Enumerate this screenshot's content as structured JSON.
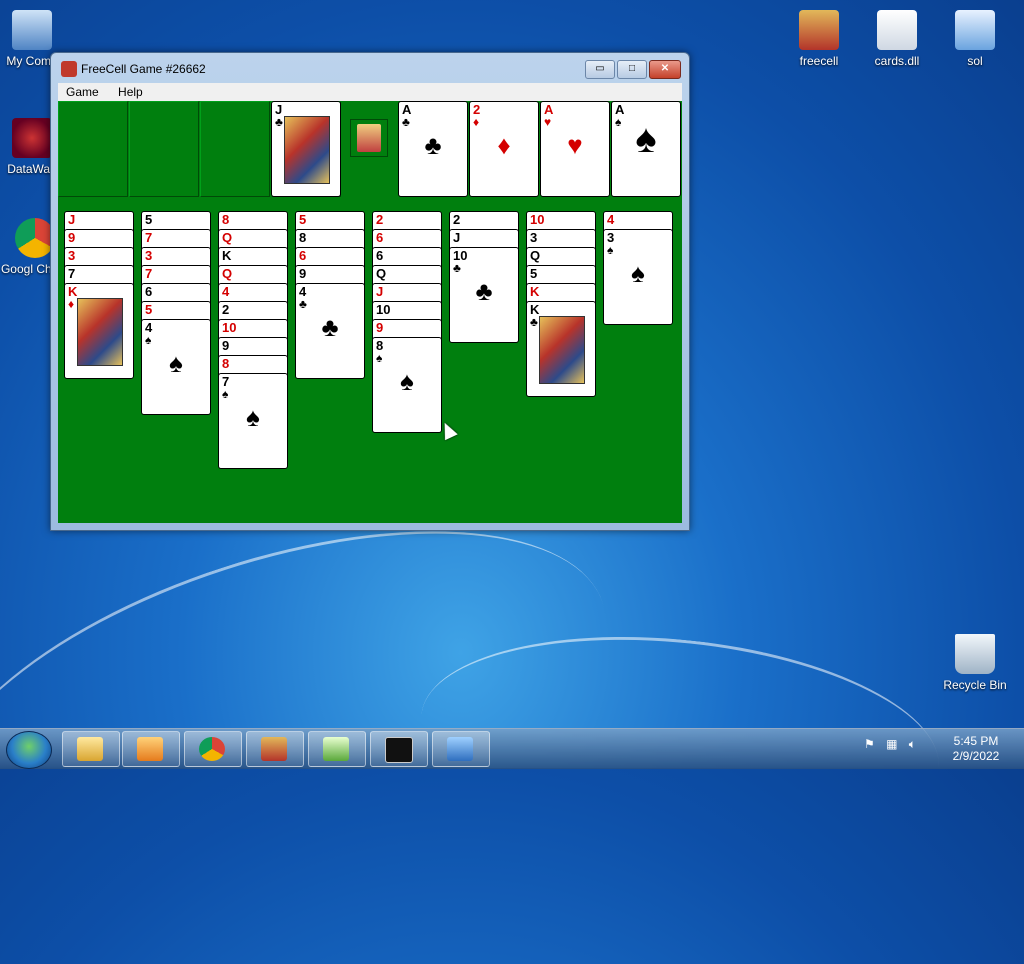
{
  "desktop": {
    "icons": [
      {
        "label": "My Comp"
      },
      {
        "label": "DataWag"
      },
      {
        "label": "Googl Chron"
      },
      {
        "label": "freecell"
      },
      {
        "label": "cards.dll"
      },
      {
        "label": "sol"
      },
      {
        "label": "Recycle Bin"
      }
    ]
  },
  "window": {
    "title": "FreeCell Game #26662",
    "buttons": {
      "minimize": "▭",
      "maximize": "□",
      "close": "✕"
    },
    "menu": [
      "Game",
      "Help"
    ]
  },
  "game": {
    "freecell_card": {
      "rank": "J",
      "suit": "♣",
      "color": "black"
    },
    "foundations": [
      {
        "rank": "A",
        "suit": "♣",
        "color": "black"
      },
      {
        "rank": "2",
        "suit": "♦",
        "color": "red"
      },
      {
        "rank": "A",
        "suit": "♥",
        "color": "red"
      },
      {
        "rank": "A",
        "suit": "♠",
        "color": "black"
      }
    ],
    "columns": [
      [
        {
          "r": "J",
          "s": "♥"
        },
        {
          "r": "9",
          "s": "♥"
        },
        {
          "r": "3",
          "s": "♥"
        },
        {
          "r": "7",
          "s": "♠"
        },
        {
          "r": "K",
          "s": "♦"
        }
      ],
      [
        {
          "r": "5",
          "s": "♠"
        },
        {
          "r": "7",
          "s": "♥"
        },
        {
          "r": "3",
          "s": "♥"
        },
        {
          "r": "7",
          "s": "♥"
        },
        {
          "r": "6",
          "s": "♠"
        },
        {
          "r": "5",
          "s": "♥"
        },
        {
          "r": "4",
          "s": "♠"
        }
      ],
      [
        {
          "r": "8",
          "s": "♥"
        },
        {
          "r": "Q",
          "s": "♥"
        },
        {
          "r": "K",
          "s": "♠"
        },
        {
          "r": "Q",
          "s": "♥"
        },
        {
          "r": "4",
          "s": "♦"
        },
        {
          "r": "2",
          "s": "♠"
        },
        {
          "r": "10",
          "s": "♥"
        },
        {
          "r": "9",
          "s": "♠"
        },
        {
          "r": "8",
          "s": "♥"
        },
        {
          "r": "7",
          "s": "♠"
        }
      ],
      [
        {
          "r": "5",
          "s": "♥"
        },
        {
          "r": "8",
          "s": "♠"
        },
        {
          "r": "6",
          "s": "♥"
        },
        {
          "r": "9",
          "s": "♠"
        },
        {
          "r": "4",
          "s": "♣"
        }
      ],
      [
        {
          "r": "2",
          "s": "♥"
        },
        {
          "r": "6",
          "s": "♥"
        },
        {
          "r": "6",
          "s": "♠"
        },
        {
          "r": "Q",
          "s": "♠"
        },
        {
          "r": "J",
          "s": "♥"
        },
        {
          "r": "10",
          "s": "♠"
        },
        {
          "r": "9",
          "s": "♥"
        },
        {
          "r": "8",
          "s": "♠"
        }
      ],
      [
        {
          "r": "2",
          "s": "♠"
        },
        {
          "r": "J",
          "s": "♣"
        },
        {
          "r": "10",
          "s": "♣"
        }
      ],
      [
        {
          "r": "10",
          "s": "♥"
        },
        {
          "r": "3",
          "s": "♠"
        },
        {
          "r": "Q",
          "s": "♠"
        },
        {
          "r": "5",
          "s": "♠"
        },
        {
          "r": "K",
          "s": "♥"
        },
        {
          "r": "K",
          "s": "♣"
        }
      ],
      [
        {
          "r": "4",
          "s": "♥"
        },
        {
          "r": "3",
          "s": "♠"
        }
      ]
    ]
  },
  "taskbar": {
    "clock_time": "5:45 PM",
    "clock_date": "2/9/2022"
  }
}
